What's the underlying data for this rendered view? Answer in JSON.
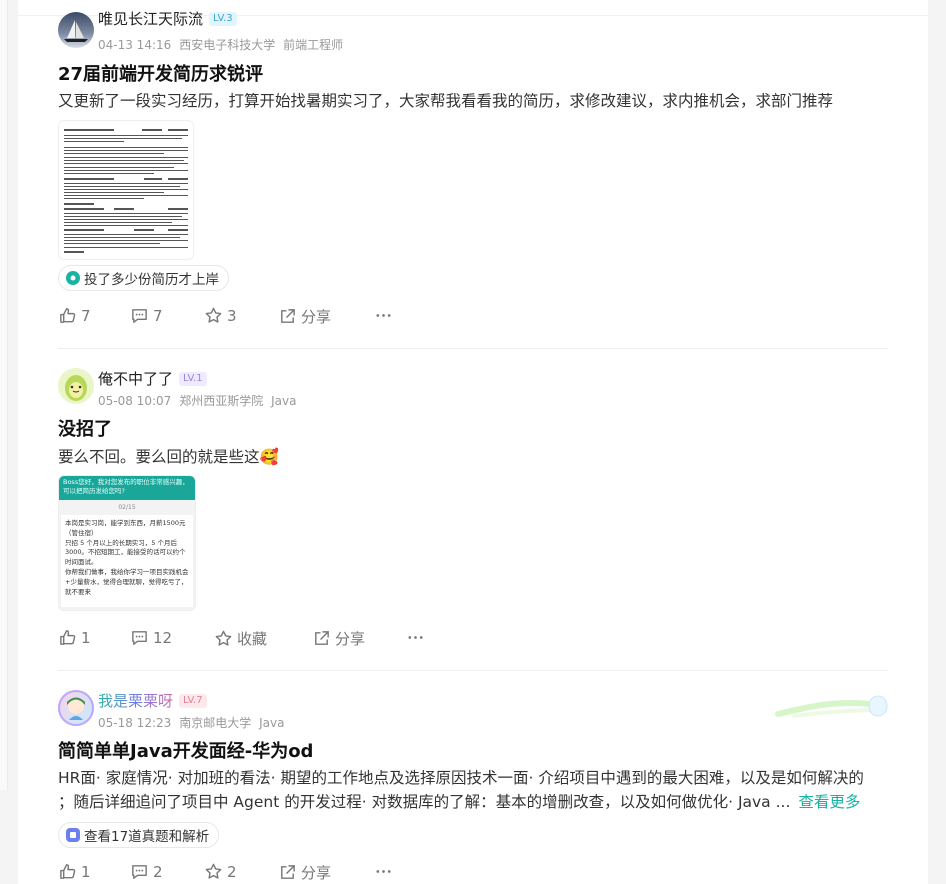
{
  "posts": [
    {
      "author": "唯见长江天际流",
      "level": "LV.3",
      "date": "04-13 14:16",
      "school": "西安电子科技大学",
      "role": "前端工程师",
      "title": "27届前端开发简历求锐评",
      "body": "又更新了一段实习经历，打算开始找暑期实习了，大家帮我看看我的简历，求修改建议，求内推机会，求部门推荐",
      "tag": "投了多少份简历才上岸",
      "likes": "7",
      "comments": "7",
      "stars": "3",
      "share": "分享"
    },
    {
      "author": "俺不中了了",
      "level": "LV.1",
      "date": "05-08 10:07",
      "school": "郑州西亚斯学院",
      "role": "Java",
      "title": "没招了",
      "body": "要么不回。要么回的就是些这🥰",
      "chat": {
        "bubble": "Boss您好，我对您发布的职位非常感兴趣，可以把简历发给您吗?",
        "time": "02/15",
        "lines": [
          "本岗是实习岗，能学到东西，月薪1500元",
          "（管住宿）",
          "只招 5 个月以上的长期实习，5 个月后",
          "3000。不招短期工，能接受的话可以约个",
          "时间面试。",
          "你帮我们做事，我给你学习一项目实践机会",
          "+少量薪水，觉得合理就聊，觉得吃亏了，",
          "就不要来"
        ]
      },
      "likes": "1",
      "comments": "12",
      "stars": "收藏",
      "share": "分享"
    },
    {
      "author": "我是栗栗呀",
      "level": "LV.7",
      "date": "05-18 12:23",
      "school": "南京邮电大学",
      "role": "Java",
      "title": "简简单单Java开发面经-华为od",
      "body_line1": "HR面· 家庭情况· 对加班的看法· 期望的工作地点及选择原因技术一面· 介绍项目中遇到的最大困难，以及是如何解决的",
      "body_line2": "；随后详细追问了项目中 Agent 的开发过程· 对数据库的了解：基本的增删改查，以及如何做优化· Java  ...",
      "more": "查看更多",
      "tag": "查看17道真题和解析",
      "likes": "1",
      "comments": "2",
      "stars": "2",
      "share": "分享"
    }
  ],
  "colors": {
    "accent": "#17b3a3",
    "lv3_bg": "#e3f4fb",
    "lv3_fg": "#3aa6d6",
    "lv1_bg": "#efeaff",
    "lv1_fg": "#9a85e0",
    "lv7_bg": "#fde9ec",
    "lv7_fg": "#e77f93"
  }
}
